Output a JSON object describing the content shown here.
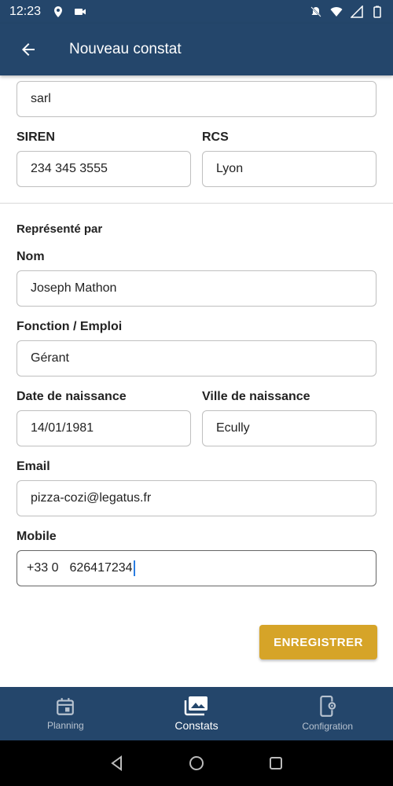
{
  "status_bar": {
    "time": "12:23",
    "left_icons": [
      "location-icon",
      "video-icon"
    ],
    "right_icons": [
      "bell-off-icon",
      "wifi-icon",
      "signal-icon",
      "battery-icon"
    ]
  },
  "app_bar": {
    "title": "Nouveau constat",
    "back_icon": "arrow-back-icon"
  },
  "form": {
    "forme_juridique": {
      "value": "sarl"
    },
    "siren": {
      "label": "SIREN",
      "value": "234 345 3555"
    },
    "rcs": {
      "label": "RCS",
      "value": "Lyon"
    },
    "represente_par": "Représenté par",
    "nom": {
      "label": "Nom",
      "value": "Joseph Mathon"
    },
    "fonction": {
      "label": "Fonction / Emploi",
      "value": "Gérant"
    },
    "date_naissance": {
      "label": "Date de naissance",
      "value": "14/01/1981"
    },
    "ville_naissance": {
      "label": "Ville de naissance",
      "value": "Ecully"
    },
    "email": {
      "label": "Email",
      "value": "pizza-cozi@legatus.fr"
    },
    "mobile": {
      "label": "Mobile",
      "prefix": "+33 0",
      "value": "626417234"
    }
  },
  "save_button": {
    "label": "ENREGISTRER"
  },
  "bottom_nav": {
    "items": [
      {
        "label": "Planning",
        "icon": "calendar-icon",
        "active": false
      },
      {
        "label": "Constats",
        "icon": "photos-icon",
        "active": true
      },
      {
        "label": "Configration",
        "icon": "phone-settings-icon",
        "active": false
      }
    ]
  },
  "colors": {
    "primary": "#24466b",
    "accent": "#d6a428",
    "caret": "#2a7de1"
  }
}
